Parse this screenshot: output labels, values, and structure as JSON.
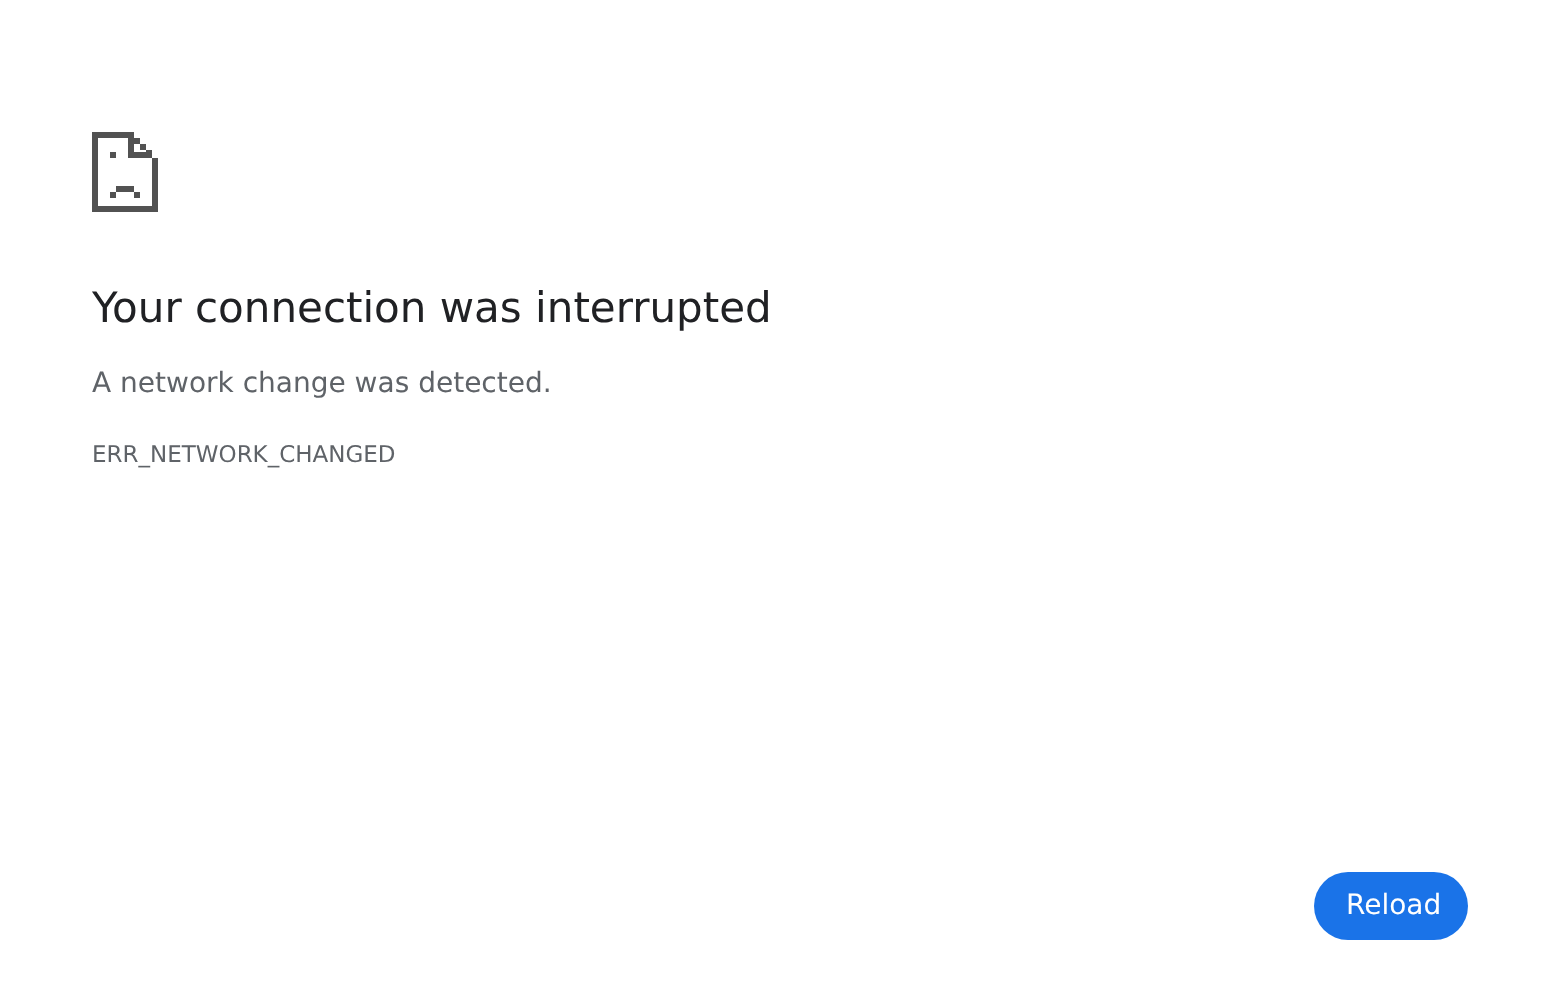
{
  "error": {
    "title": "Your connection was interrupted",
    "message": "A network change was detected.",
    "code": "ERR_NETWORK_CHANGED"
  },
  "buttons": [
    {
      "label": "Reload"
    }
  ]
}
